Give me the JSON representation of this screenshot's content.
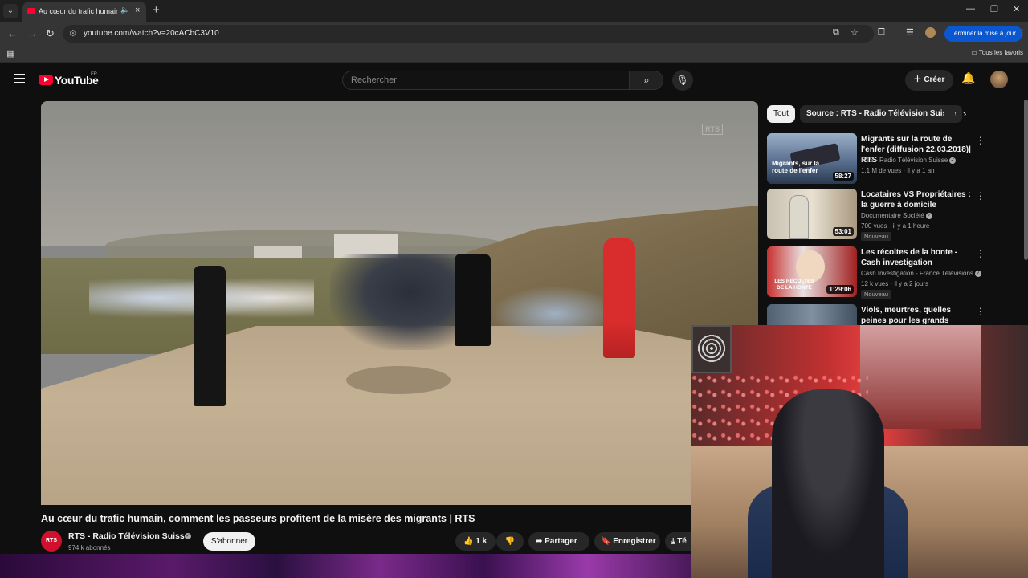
{
  "browser": {
    "tab_title": "Au cœur du trafic humain, c",
    "url": "youtube.com/watch?v=20cACbC3V10",
    "update_button": "Terminer la mise à jour",
    "all_bookmarks": "Tous les favoris"
  },
  "header": {
    "logo_text": "YouTube",
    "logo_country": "FR",
    "search_placeholder": "Rechercher",
    "create_label": "Créer"
  },
  "video": {
    "watermark": "RTS",
    "title": "Au cœur du trafic humain, comment les passeurs profitent de la misère des migrants | RTS",
    "channel_logo": "RTS",
    "channel_name": "RTS - Radio Télévision Suisse",
    "subscribers": "974 k abonnés",
    "subscribe_label": "S'abonner",
    "likes": "1 k",
    "share_label": "Partager",
    "save_label": "Enregistrer",
    "download_label": "Té"
  },
  "filters": {
    "all": "Tout",
    "source": "Source : RTS - Radio Télévision Suisse"
  },
  "recommendations": [
    {
      "title": "Migrants sur la route de l'enfer (diffusion 22.03.2018)| RTS",
      "channel": "RTS - Radio Télévision Suisse",
      "meta": "1,1 M de vues · il y a 1 an",
      "duration": "58:27",
      "thumb_text": "Migrants, sur la route de l'enfer",
      "badge": ""
    },
    {
      "title": "Locataires VS Propriétaires : la guerre à domicile",
      "channel": "Documentaire Société",
      "meta": "700 vues · il y a 1 heure",
      "duration": "53:01",
      "thumb_text": "",
      "badge": "Nouveau"
    },
    {
      "title": "Les récoltes de la honte - Cash investigation",
      "channel": "Cash Investigation - France Télévisions",
      "meta": "12 k vues · il y a 2 jours",
      "duration": "1:29:06",
      "thumb_text": "LES RÉCOLTES DE LA HONTE",
      "badge": "Nouveau"
    },
    {
      "title": "Viols, meurtres, quelles peines pour les grands assassins ? |…",
      "channel": "",
      "meta": "",
      "duration": "",
      "thumb_text": "",
      "badge": ""
    }
  ],
  "colors": {
    "brand_red": "#ff0033",
    "background": "#0f0f0f",
    "update_blue": "#0b57d0"
  },
  "icons": {
    "menu": "hamburger-icon",
    "search": "search-icon",
    "mic": "microphone-icon",
    "bell": "bell-icon"
  }
}
